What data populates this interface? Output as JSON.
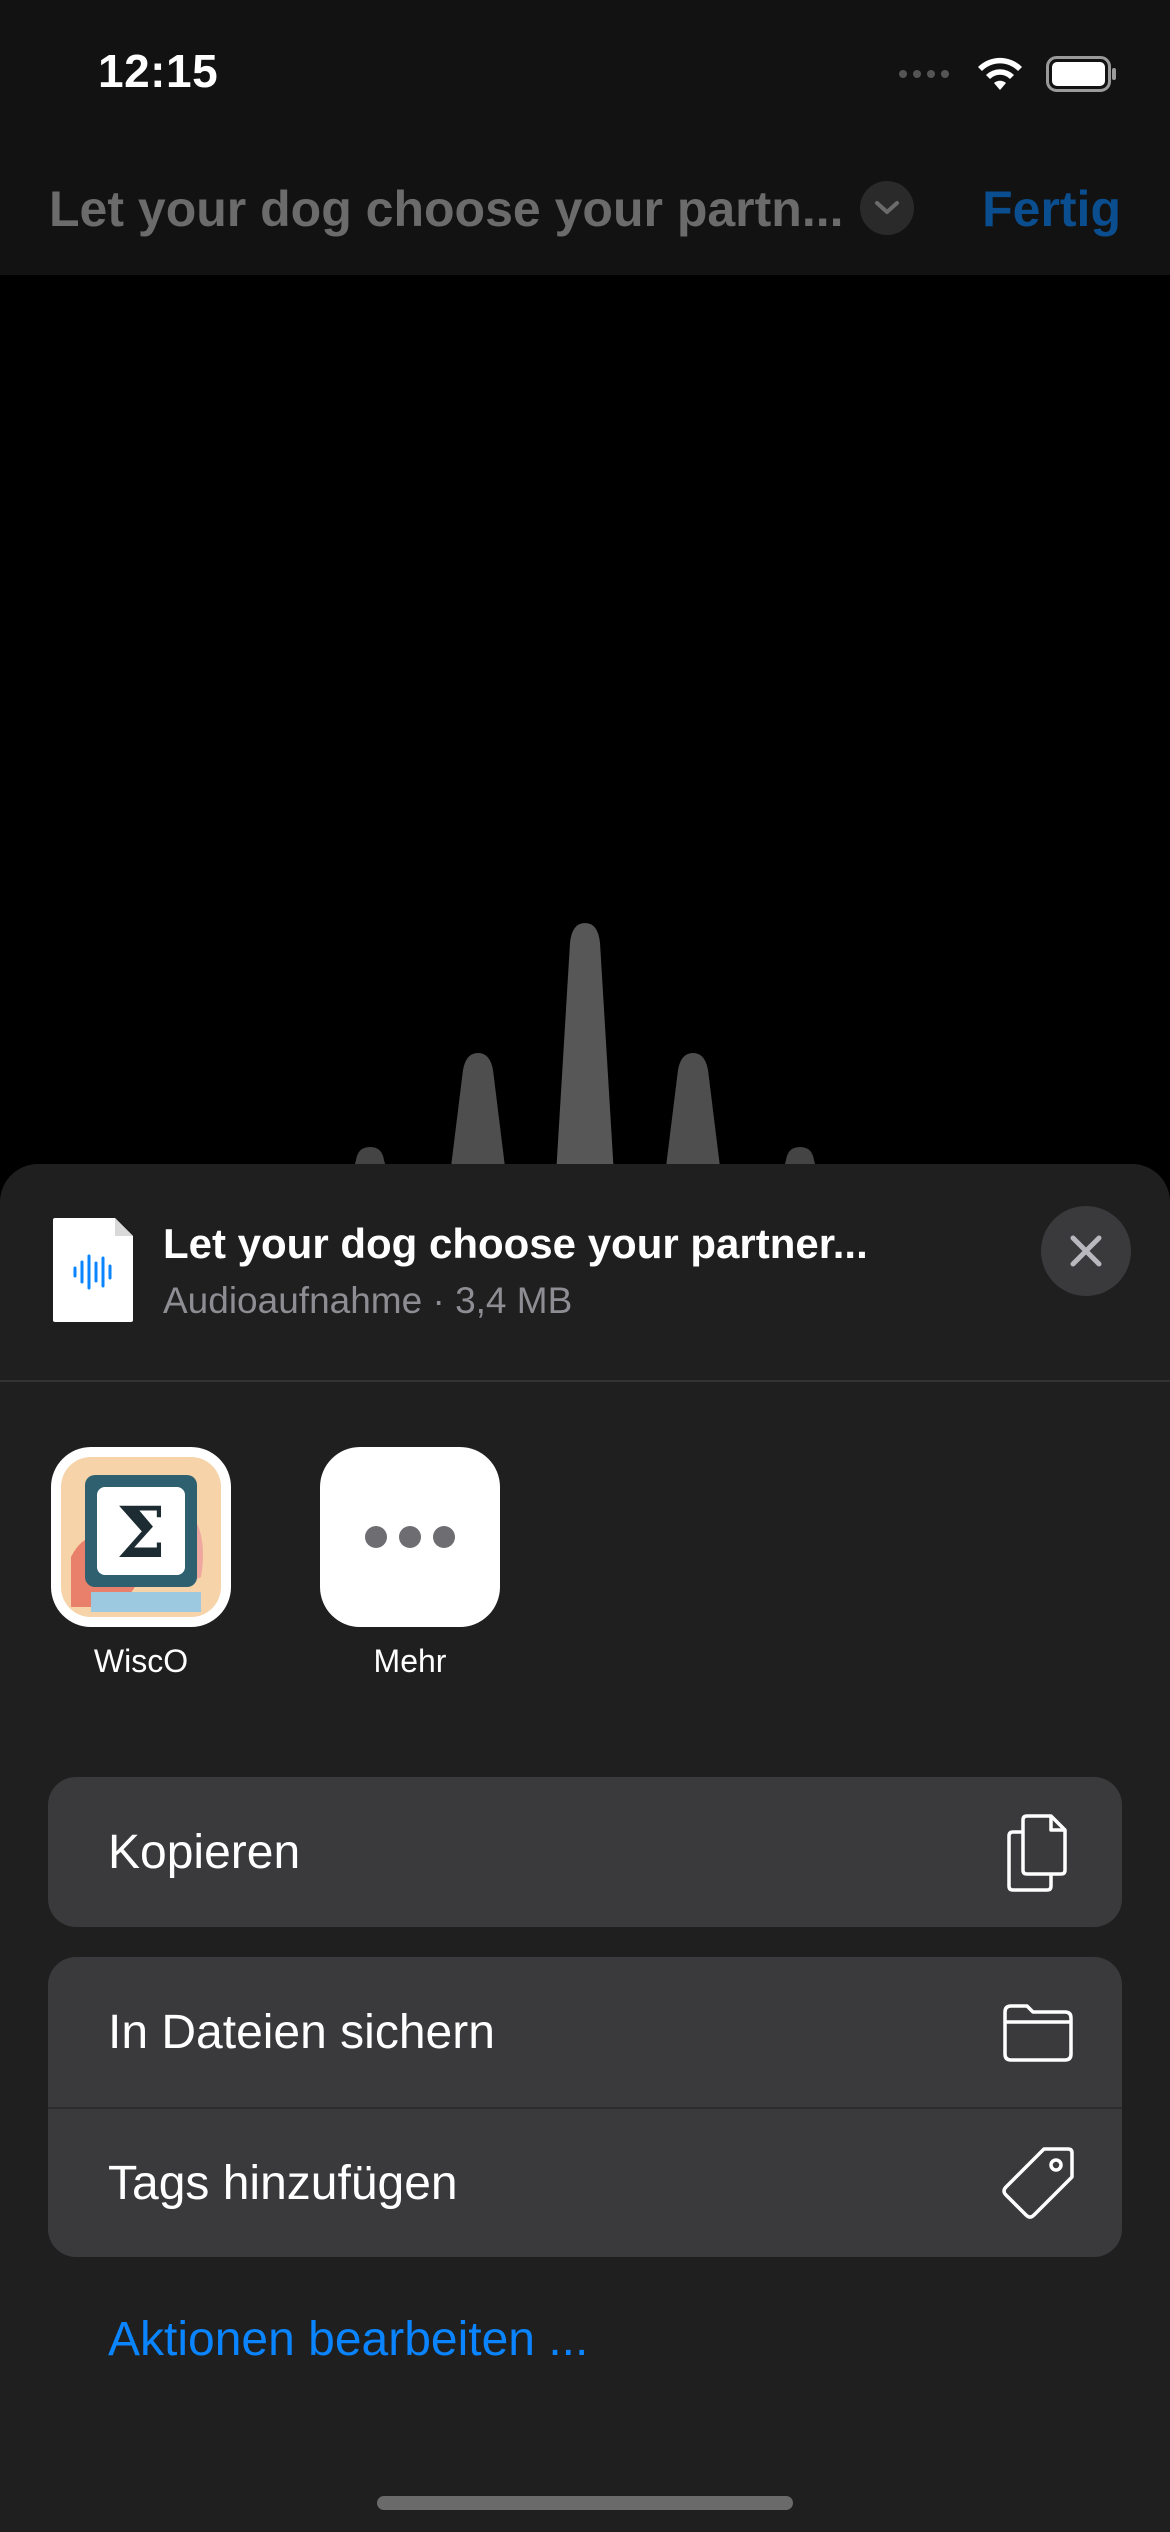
{
  "status_bar": {
    "time": "12:15"
  },
  "nav": {
    "title": "Let your dog choose your partn...",
    "done_label": "Fertig"
  },
  "share_sheet": {
    "file_title": "Let your dog choose your partner...",
    "file_subtitle": "Audioaufnahme · 3,4 MB",
    "apps": [
      {
        "label": "WiscO",
        "icon": "wisco-app-icon"
      },
      {
        "label": "Mehr",
        "icon": "more-icon"
      }
    ],
    "actions_group1": [
      {
        "label": "Kopieren",
        "icon": "copy-icon"
      }
    ],
    "actions_group2": [
      {
        "label": "In Dateien sichern",
        "icon": "folder-icon"
      },
      {
        "label": "Tags hinzufügen",
        "icon": "tag-icon"
      }
    ],
    "edit_actions_label": "Aktionen bearbeiten ..."
  },
  "colors": {
    "accent": "#0a84ff",
    "sheet_background": "#1f1f1f",
    "row_background": "#3a3a3c"
  }
}
